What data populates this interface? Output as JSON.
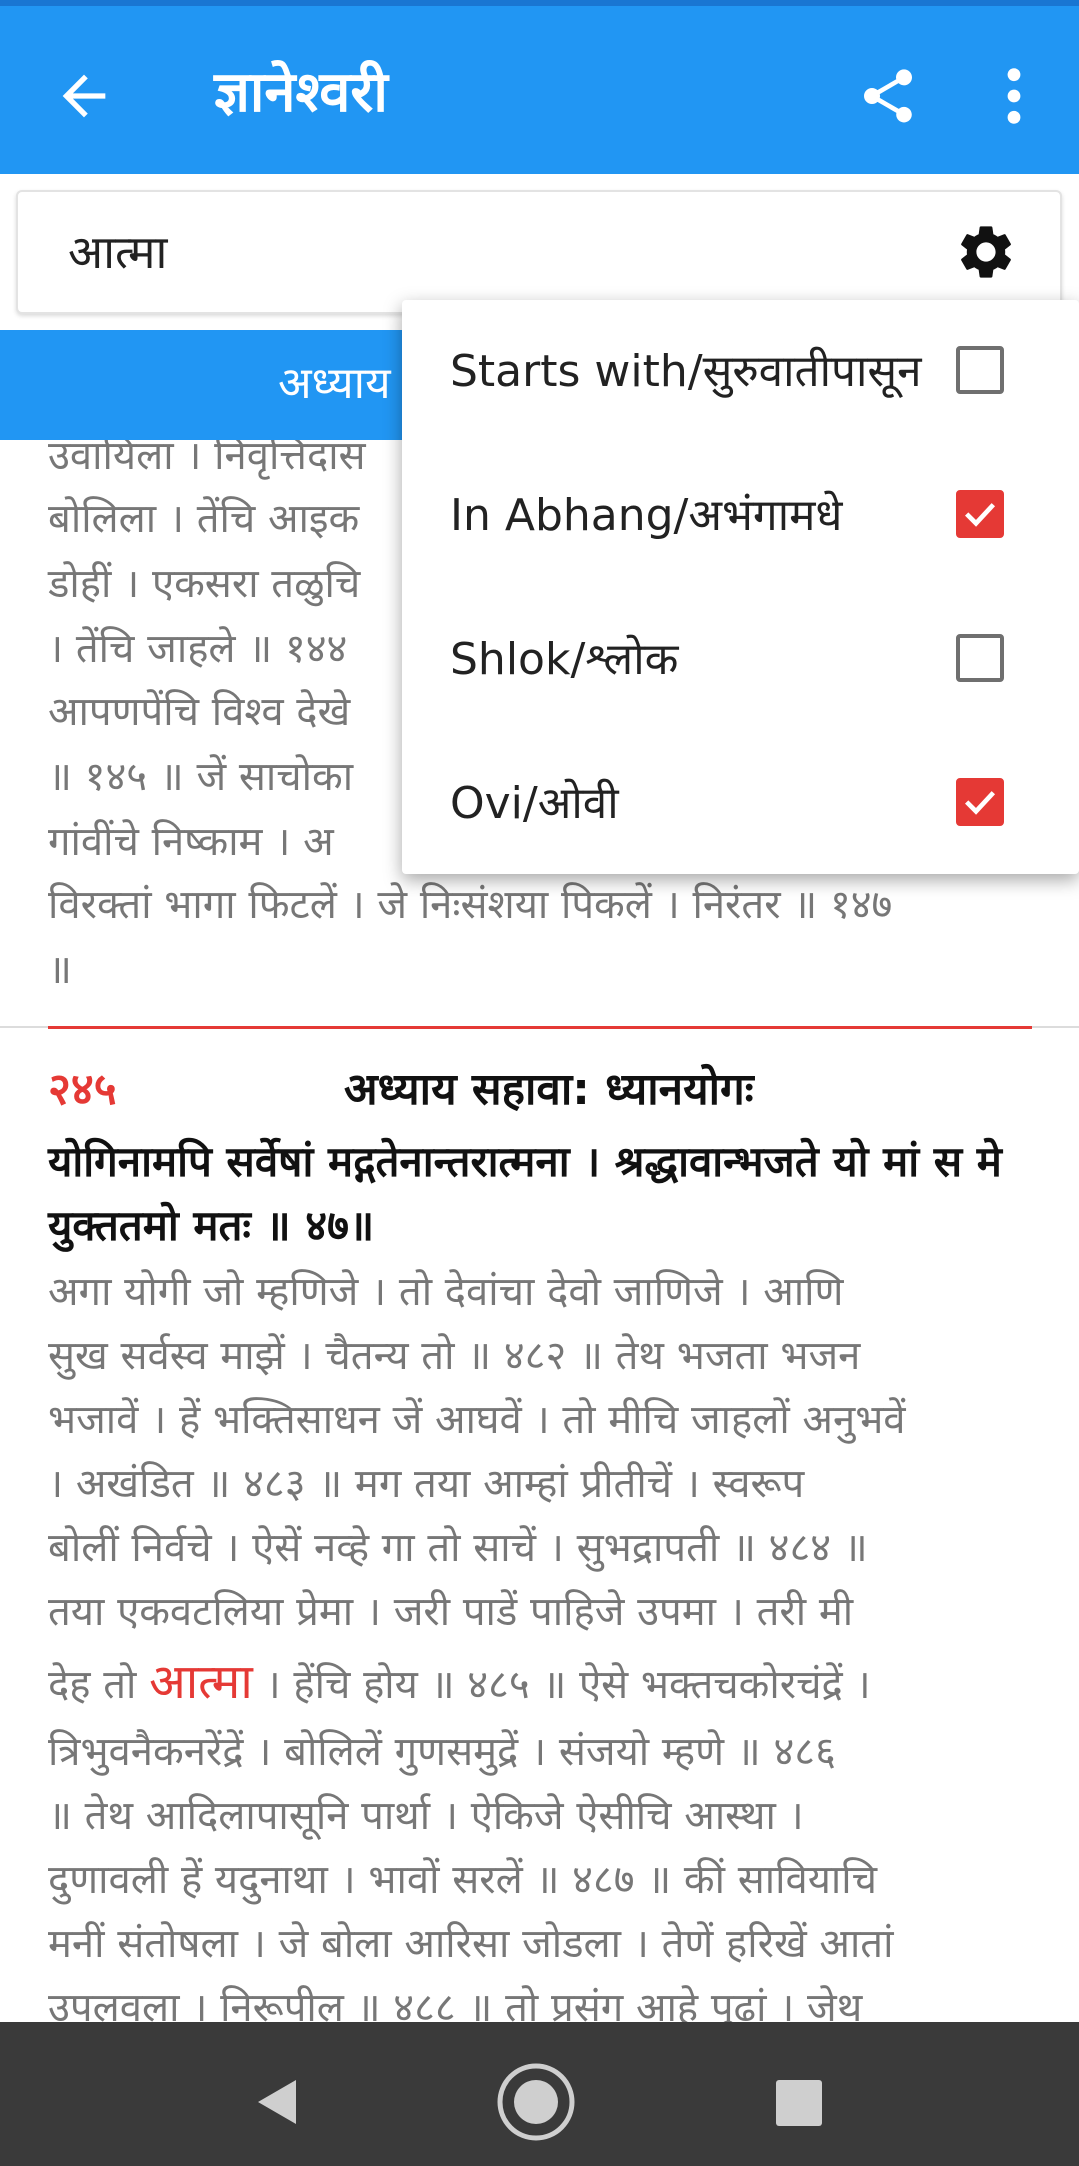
{
  "app_bar": {
    "title": "ज्ञानेश्वरी",
    "back_icon": "arrow-back-icon",
    "share_icon": "share-icon",
    "more_icon": "more-vert-icon",
    "color": "#2196F3"
  },
  "search": {
    "value": "आत्मा",
    "settings_icon": "gear-icon"
  },
  "tab": {
    "label": "अध्याय"
  },
  "results": [
    {
      "ovi_lines": [
        "उवायिला । निवृत्तिदास",
        "बोलिला । तेंचि आइक",
        "डोहीं । एकसरा तळुचि",
        "। तेंचि जाहले ॥ १४४",
        "आपणपेंचि विश्व देखे",
        "॥ १४५ ॥ जें साचोका",
        "गांवींचे निष्काम । अ",
        "विरक्तां भागा फिटलें । जे निःसंशया पिकलें । निरंतर ॥ १४७",
        "॥"
      ]
    },
    {
      "number": "२४५",
      "chapter": "अध्याय सहावा: ध्यानयोगः",
      "shlok": "योगिनामपि सर्वेषां मद्गतेनान्तरात्मना । श्रद्धावान्भजते यो मां स मे युक्ततमो मतः ॥ ४७॥",
      "ovi_lines": [
        "अगा योगी जो म्हणिजे । तो देवांचा देवो जाणिजे । आणि",
        "सुख सर्वस्व माझें । चैतन्य तो ॥ ४८२ ॥ तेथ भजता भजन",
        "भजावें । हें भक्तिसाधन जें आघवें । तो मीचि जाहलों अनुभवें",
        "। अखंडित ॥ ४८३ ॥ मग तया आम्हां प्रीतीचें । स्वरूप",
        "बोलीं निर्वचे । ऐसें नव्हे गा तो साचें । सुभद्रापती ॥ ४८४ ॥",
        "तया एकवटलिया प्रेमा । जरी पाडें पाहिजे उपमा । तरी मी"
      ],
      "highlight_line": {
        "before": "देह तो ",
        "match": "आत्मा",
        "after": " । हेंचि होय ॥ ४८५ ॥ ऐसे भक्तचकोरचंद्रें ।"
      },
      "ovi_lines_after": [
        "त्रिभुवनैकनरेंद्रें । बोलिलें गुणसमुद्रें । संजयो म्हणे ॥ ४८६",
        "॥ तेथ आदिलापासूनि पार्था । ऐकिजे ऐसीचि आस्था ।",
        "दुणावली हें यदुनाथा । भावों सरलें ॥ ४८७ ॥ कीं सावियाचि",
        "मनीं संतोषला । जे बोला आरिसा जोडला । तेणें हरिखें आतां",
        "उपलवला । निरूपील ॥ ४८८ ॥ तो प्रसंग आहे पुढां । जेथ"
      ]
    }
  ],
  "filter_menu": {
    "options": [
      {
        "label": "Starts with/सुरुवातीपासून",
        "checked": false
      },
      {
        "label": "In Abhang/अभंगामधे",
        "checked": true
      },
      {
        "label": "Shlok/श्लोक",
        "checked": false
      },
      {
        "label": "Ovi/ओवी",
        "checked": true
      }
    ],
    "check_color": "#e53935"
  },
  "nav_bar": {
    "back_icon": "nav-back-icon",
    "home_icon": "nav-home-icon",
    "recents_icon": "nav-recents-icon"
  }
}
